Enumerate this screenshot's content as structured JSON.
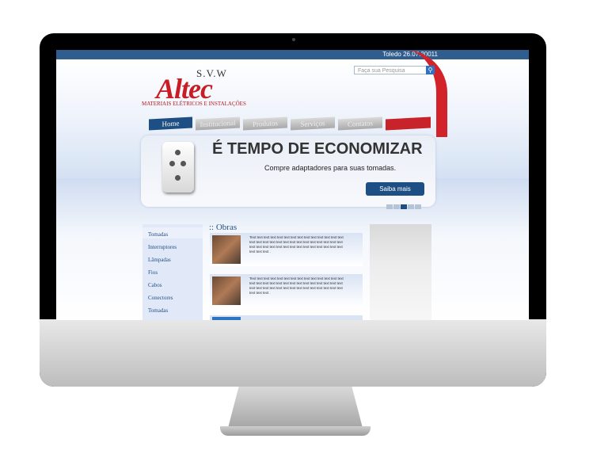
{
  "header": {
    "date": "Toledo 26.07.20011",
    "search_placeholder": "Faça sua Pesquisa",
    "search_icon": "magnifier-icon"
  },
  "logo": {
    "svw": "S.V.W",
    "name": "Altec",
    "tagline": "MATERIAIS ELÉTRICOS E INSTALAÇÕES"
  },
  "nav": {
    "items": [
      "Home",
      "Institucional",
      "Produtos",
      "Serviços",
      "Contatos"
    ]
  },
  "banner": {
    "headline": "É TEMPO DE ECONOMIZAR",
    "subline": "Compre adaptadores para suas tomadas.",
    "button": "Saiba mais",
    "slide_count": 5,
    "active_slide": 3
  },
  "sidebar": {
    "items": [
      "Tomadas",
      "Interruptores",
      "Lâmpadas",
      "Fios",
      "Cabos",
      "Conectores",
      "Tomadas"
    ]
  },
  "obras": {
    "title": ":: Obras",
    "cards": [
      {
        "text": "Text text text text text text text text text text text text text text text text text text text text text text text text text text text text text text text text text text text text text text text text text text text text text ."
      },
      {
        "text": "Text text text text text text text text text text text text text text text text text text text text text text text text text text text text text text text text text text text text text text text text text text text text text ."
      }
    ]
  },
  "colors": {
    "brand_blue": "#1e4f84",
    "brand_red": "#c81d25"
  }
}
